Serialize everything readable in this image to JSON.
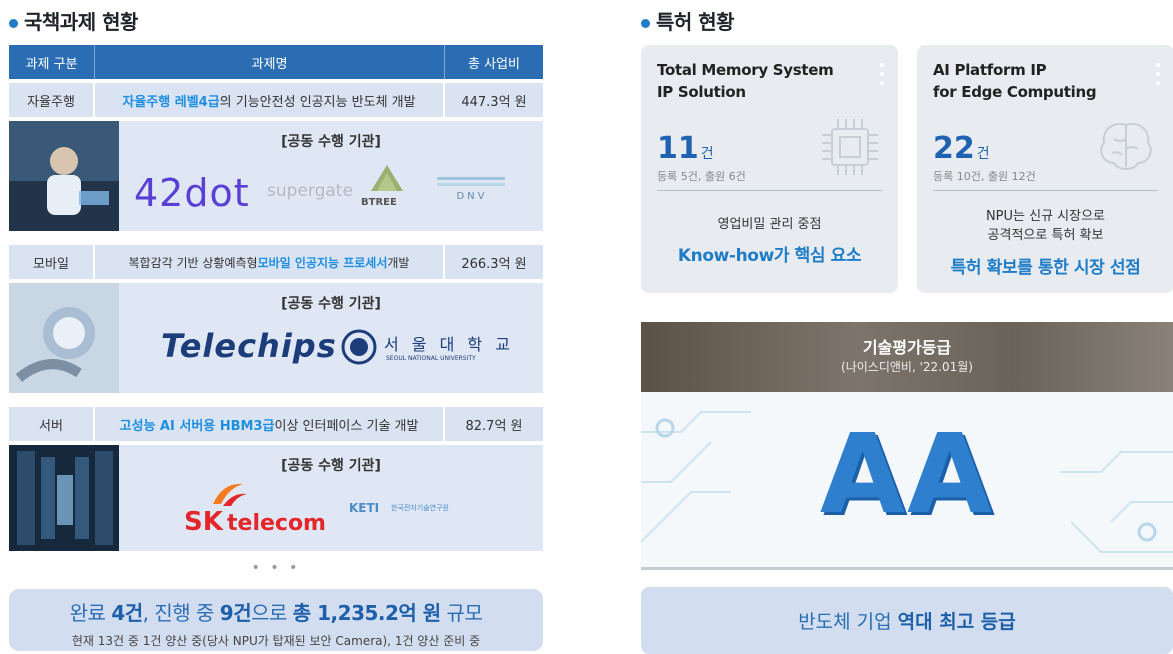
{
  "left": {
    "title": "국책과제 현황",
    "header": {
      "col1": "과제 구분",
      "col2": "과제명",
      "col3": "총 사업비"
    },
    "rows": [
      {
        "category": "자율주행",
        "name_hl": "자율주행 레벨4급",
        "name_rest": "의 기능안전성 인공지능 반도체 개발",
        "budget": "447.3억 원",
        "panel_label": "[공동 수행 기관]",
        "orgs": [
          "42dot",
          "supergate",
          "BTREE",
          "DNV"
        ]
      },
      {
        "category": "모바일",
        "name_pre": "복합감각 기반 상황예측형 ",
        "name_hl": "모바일 인공지능 프로세서",
        "name_rest": " 개발",
        "budget": "266.3억 원",
        "panel_label": "[공동 수행 기관]",
        "orgs": [
          "Telechips",
          "서 울 대 학 교",
          "SEOUL NATIONAL UNIVERSITY"
        ]
      },
      {
        "category": "서버",
        "name_hl": "고성능 AI 서버용 HBM3급",
        "name_rest": " 이상 인터페이스 기술 개발",
        "budget": "82.7억 원",
        "panel_label": "[공동 수행 기관]",
        "orgs": [
          "SK",
          "telecom",
          "KETI",
          "한국전자기술연구원"
        ]
      }
    ],
    "ellipsis": "• • •",
    "summary": {
      "p1": "완료 ",
      "b1": "4건",
      "p2": ", 진행 중 ",
      "b2": "9건",
      "p3": "으로 ",
      "b3": "총 1,235.2억 원",
      "p4": " 규모",
      "line2": "현재 13건 중 1건 양산 중(당사 NPU가 탑재된 보안 Camera), 1건 양산 준비 중"
    }
  },
  "right": {
    "title": "특허 현황",
    "cards": [
      {
        "title_l1": "Total Memory System",
        "title_l2": "IP Solution",
        "count": "11",
        "unit": "건",
        "sub": "등록 5건, 출원 6건",
        "desc": "영업비밀 관리 중점",
        "key": "Know-how가 핵심 요소",
        "icon": "chip-icon"
      },
      {
        "title_l1": "AI Platform IP",
        "title_l2": "for Edge Computing",
        "count": "22",
        "unit": "건",
        "sub": "등록 10건, 출원 12건",
        "desc_l1": "NPU는 신규 시장으로",
        "desc_l2": "공격적으로 특허 확보",
        "key": "특허 확보를 통한 시장 선점",
        "icon": "brain-icon"
      }
    ],
    "grade": {
      "title": "기술평가등급",
      "sub": "(나이스디앤비, '22.01월)",
      "value": "AA"
    },
    "banner": {
      "plain": "반도체 기업",
      "bold": "역대 최고 등급"
    }
  }
}
